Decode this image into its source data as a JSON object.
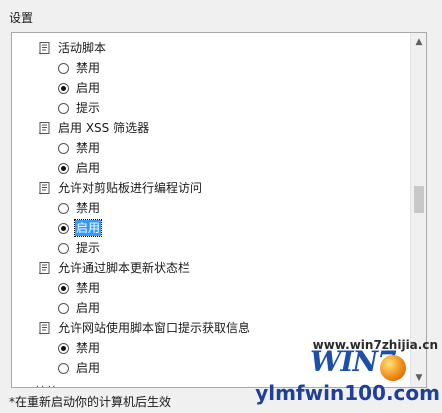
{
  "settings": {
    "group_label": "设置",
    "footer_note": "*在重新启动你的计算机后生效",
    "items": [
      {
        "kind": "policy",
        "label": "活动脚本"
      },
      {
        "kind": "option",
        "label": "禁用",
        "checked": false,
        "selected": false
      },
      {
        "kind": "option",
        "label": "启用",
        "checked": true,
        "selected": false
      },
      {
        "kind": "option",
        "label": "提示",
        "checked": false,
        "selected": false
      },
      {
        "kind": "policy",
        "label": "启用 XSS 筛选器"
      },
      {
        "kind": "option",
        "label": "禁用",
        "checked": false,
        "selected": false
      },
      {
        "kind": "option",
        "label": "启用",
        "checked": true,
        "selected": false
      },
      {
        "kind": "policy",
        "label": "允许对剪贴板进行编程访问"
      },
      {
        "kind": "option",
        "label": "禁用",
        "checked": false,
        "selected": false
      },
      {
        "kind": "option",
        "label": "启用",
        "checked": true,
        "selected": true
      },
      {
        "kind": "option",
        "label": "提示",
        "checked": false,
        "selected": false
      },
      {
        "kind": "policy",
        "label": "允许通过脚本更新状态栏"
      },
      {
        "kind": "option",
        "label": "禁用",
        "checked": true,
        "selected": false
      },
      {
        "kind": "option",
        "label": "启用",
        "checked": false,
        "selected": false
      },
      {
        "kind": "policy",
        "label": "允许网站使用脚本窗口提示获取信息"
      },
      {
        "kind": "option",
        "label": "禁用",
        "checked": true,
        "selected": false
      },
      {
        "kind": "option",
        "label": "启用",
        "checked": false,
        "selected": false
      }
    ],
    "partial_folder_label": "其他"
  },
  "watermark": {
    "top_text": "www.win7zhijia.cn",
    "logo_text": "WIN7",
    "domain_text": "ylmfwin100.com"
  },
  "colors": {
    "selection": "#3399ff",
    "panel_border": "#a9a9a9",
    "window_bg": "#f0f0f0"
  }
}
